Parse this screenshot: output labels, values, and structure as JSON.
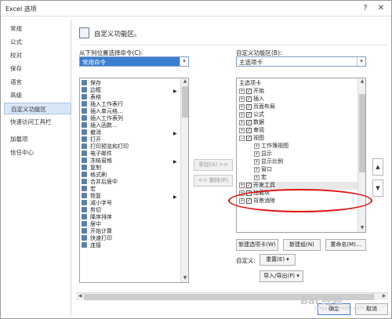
{
  "window": {
    "title": "Excel 选项",
    "help_icon": "?",
    "close_icon": "✕"
  },
  "nav": {
    "items": [
      {
        "label": "常规"
      },
      {
        "label": "公式"
      },
      {
        "label": "校对"
      },
      {
        "label": "保存"
      },
      {
        "label": "语言"
      },
      {
        "label": "高级"
      },
      {
        "label": "自定义功能区",
        "selected": true
      },
      {
        "label": "快速访问工具栏"
      },
      {
        "label": "加载项"
      },
      {
        "label": "信任中心"
      }
    ]
  },
  "main": {
    "header": "自定义功能区。",
    "left_label": "从下列位置选择命令(C):",
    "left_combo": "常用命令",
    "right_label": "自定义功能区(B):",
    "right_combo": "主选项卡",
    "commands": [
      {
        "label": "保存"
      },
      {
        "label": "边框",
        "submenu": true
      },
      {
        "label": "表格"
      },
      {
        "label": "插入工作表行"
      },
      {
        "label": "插入单元格..."
      },
      {
        "label": "插入工作表列"
      },
      {
        "label": "插入函数..."
      },
      {
        "label": "撤消",
        "submenu": true
      },
      {
        "label": "打开"
      },
      {
        "label": "打印预览和打印"
      },
      {
        "label": "电子邮件"
      },
      {
        "label": "冻结窗格",
        "submenu": true
      },
      {
        "label": "复制"
      },
      {
        "label": "格式刷"
      },
      {
        "label": "合并后居中"
      },
      {
        "label": "宏"
      },
      {
        "label": "恢复",
        "submenu": true
      },
      {
        "label": "减小字号"
      },
      {
        "label": "剪切"
      },
      {
        "label": "降序排序"
      },
      {
        "label": "居中"
      },
      {
        "label": "开始计算"
      },
      {
        "label": "快速打印"
      },
      {
        "label": "连接"
      }
    ],
    "add_button": "添加(A) >>",
    "remove_button": "<< 删除(R)",
    "tree_header": "主选项卡",
    "tree": [
      {
        "label": "开始",
        "level": 0,
        "checked": true,
        "exp": "+"
      },
      {
        "label": "插入",
        "level": 0,
        "checked": true,
        "exp": "+"
      },
      {
        "label": "页面布局",
        "level": 0,
        "checked": true,
        "exp": "+"
      },
      {
        "label": "公式",
        "level": 0,
        "checked": true,
        "exp": "+"
      },
      {
        "label": "数据",
        "level": 0,
        "checked": true,
        "exp": "+"
      },
      {
        "label": "审阅",
        "level": 0,
        "checked": true,
        "exp": "+"
      },
      {
        "label": "视图",
        "level": 0,
        "checked": true,
        "exp": "−"
      },
      {
        "label": "工作簿视图",
        "level": 1,
        "exp": "+"
      },
      {
        "label": "显示",
        "level": 1,
        "exp": "+"
      },
      {
        "label": "显示比例",
        "level": 1,
        "exp": "+"
      },
      {
        "label": "窗口",
        "level": 1,
        "exp": "+"
      },
      {
        "label": "宏",
        "level": 1,
        "exp": "+"
      },
      {
        "label": "开发工具",
        "level": 0,
        "checked": true,
        "exp": "+",
        "highlight": true
      },
      {
        "label": "加载项",
        "level": 0,
        "checked": true,
        "exp": "+"
      },
      {
        "label": "背景消除",
        "level": 0,
        "checked": true,
        "exp": "+"
      }
    ],
    "new_tab_button": "新建选项卡(W)",
    "new_group_button": "新建组(N)",
    "rename_button": "重命名(M)...",
    "customize_label": "自定义:",
    "reset_button": "重置(E) ▾",
    "import_export_button": "导入/导出(P) ▾",
    "up_arrow": "▲",
    "down_arrow": "▼"
  },
  "footer": {
    "ok_button": "确定",
    "cancel_button": "取消"
  },
  "watermark": {
    "text": "Bai 经验",
    "sub": "jingyan.baidu.com"
  }
}
